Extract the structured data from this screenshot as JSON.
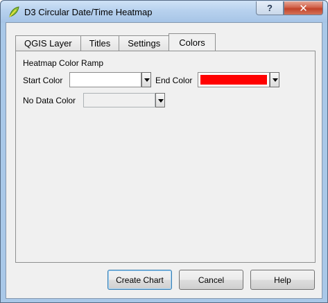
{
  "window": {
    "title": "D3 Circular Date/Time Heatmap",
    "help_glyph": "?",
    "close_glyph": "✕"
  },
  "tabs": [
    {
      "label": "QGIS Layer",
      "active": false
    },
    {
      "label": "Titles",
      "active": false
    },
    {
      "label": "Settings",
      "active": false
    },
    {
      "label": "Colors",
      "active": true
    }
  ],
  "colors_panel": {
    "section_label": "Heatmap Color Ramp",
    "start_color": {
      "label": "Start Color",
      "value": "#ffffff"
    },
    "end_color": {
      "label": "End Color",
      "value": "#ff0000"
    },
    "no_data_color": {
      "label": "No Data Color",
      "value": "#f0f0f0",
      "enabled": false
    }
  },
  "buttons": {
    "create_chart": "Create Chart",
    "cancel": "Cancel",
    "help": "Help"
  }
}
